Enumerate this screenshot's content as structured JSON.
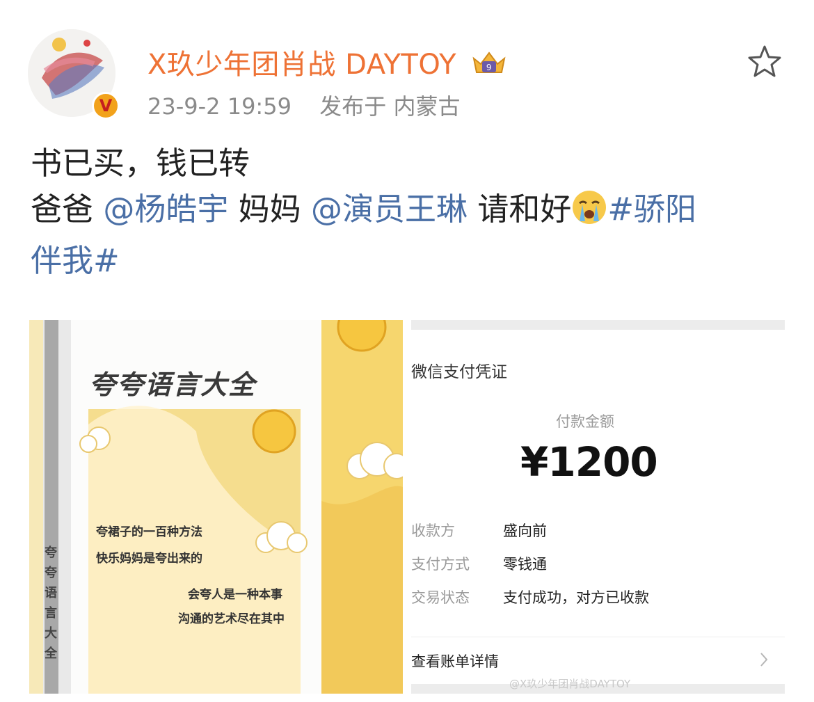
{
  "author": {
    "name": "X玖少年团肖战 DAYTOY",
    "verified_mark": "V",
    "timestamp": "23-9-2 19:59",
    "location": "发布于 内蒙古"
  },
  "post": {
    "line1": "书已买，钱已转",
    "dad": "爸爸",
    "mention1": "@杨皓宇",
    "mom": " 妈妈",
    "mention2": "@演员王琳",
    "plea": " 请和好",
    "hashtag_a": "#骄阳",
    "hashtag_b": "伴我#"
  },
  "book": {
    "title": "夸夸语言大全",
    "lines": [
      "夸裙子的一百种方法",
      "快乐妈妈是夸出来的",
      "会夸人是一种本事",
      "沟通的艺术尽在其中"
    ],
    "spine": "夸夸语言大全"
  },
  "receipt": {
    "title": "微信支付凭证",
    "amount_label": "付款金额",
    "amount": "¥1200",
    "rows": [
      {
        "key": "收款方",
        "value": "盛向前"
      },
      {
        "key": "支付方式",
        "value": "零钱通"
      },
      {
        "key": "交易状态",
        "value": "支付成功，对方已收款"
      }
    ],
    "detail_link": "查看账单详情",
    "watermark": "@X玖少年团肖战DAYTOY"
  },
  "icons": {
    "favorite": "star-outline-icon",
    "crying": "crying-emoji-icon",
    "crown": "crown-badge-icon"
  },
  "colors": {
    "username": "#ee7235",
    "link": "#4a6fa6",
    "verified_badge": "#f2a21b"
  }
}
